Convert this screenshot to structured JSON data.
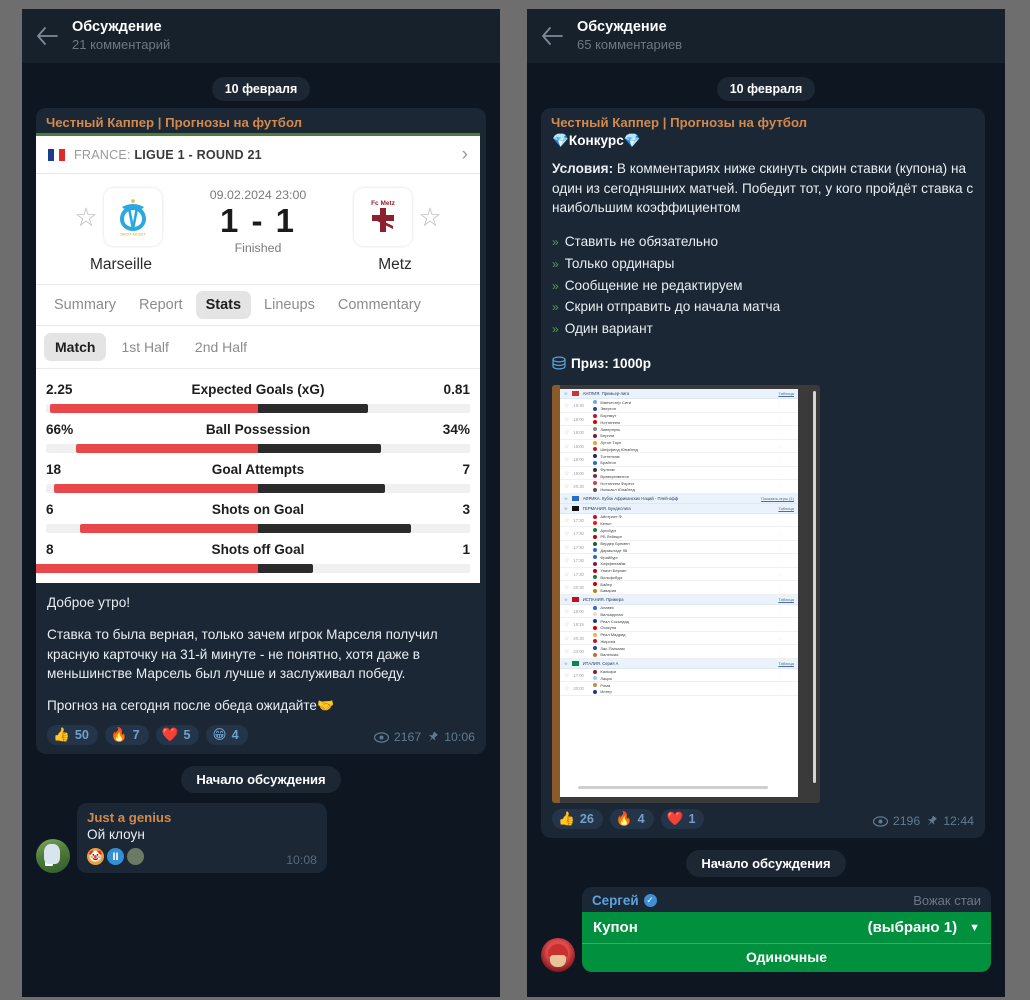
{
  "left": {
    "header": {
      "title": "Обсуждение",
      "subtitle": "21 комментарий",
      "back_icon": "back-arrow-icon"
    },
    "date_chip": "10 февраля",
    "channel": "Честный Каппер | Прогнозы на футбол",
    "sports_card": {
      "league": "FRANCE:",
      "league_bold": "LIGUE 1 - ROUND 21",
      "chevron": "›",
      "home_team": "Marseille",
      "away_team": "Metz",
      "home_logo_text": "OM",
      "away_logo_text": "Fc Metz",
      "kickoff": "09.02.2024 23:00",
      "score": "1 - 1",
      "status": "Finished",
      "tabs": [
        {
          "label": "Summary",
          "active": false
        },
        {
          "label": "Report",
          "active": false
        },
        {
          "label": "Stats",
          "active": true
        },
        {
          "label": "Lineups",
          "active": false
        },
        {
          "label": "Commentary",
          "active": false
        }
      ],
      "subtabs": [
        {
          "label": "Match",
          "active": true
        },
        {
          "label": "1st Half",
          "active": false
        },
        {
          "label": "2nd Half",
          "active": false
        }
      ],
      "stats": [
        {
          "label": "Expected Goals (xG)",
          "home": "2.25",
          "away": "0.81",
          "home_pct": 49,
          "away_pct": 26
        },
        {
          "label": "Ball Possession",
          "home": "66%",
          "away": "34%",
          "home_pct": 43,
          "away_pct": 29
        },
        {
          "label": "Goal Attempts",
          "home": "18",
          "away": "7",
          "home_pct": 48,
          "away_pct": 30
        },
        {
          "label": "Shots on Goal",
          "home": "6",
          "away": "3",
          "home_pct": 42,
          "away_pct": 36
        },
        {
          "label": "Shots off Goal",
          "home": "8",
          "away": "1",
          "home_pct": 62,
          "away_pct": 13
        }
      ]
    },
    "message_paragraphs": [
      "Доброе утро!",
      "Ставка то была верная, только зачем игрок Марселя получил красную карточку на 31-й минуте - не понятно, хотя даже в меньшинстве Марсель был лучше и заслуживал победу.",
      "Прогноз на сегодня после обеда ожидайте🤝"
    ],
    "reactions": [
      {
        "emoji": "👍",
        "count": "50"
      },
      {
        "emoji": "🔥",
        "count": "7"
      },
      {
        "emoji": "❤️",
        "count": "5"
      },
      {
        "emoji": "😁",
        "count": "4"
      }
    ],
    "views": "2167",
    "time": "10:06",
    "service_label": "Начало обсуждения",
    "comment": {
      "author": "Just a genius",
      "text": "Ой клоун",
      "time": "10:08",
      "reaction_avatars": [
        "🤡",
        "II",
        "👤"
      ]
    }
  },
  "right": {
    "header": {
      "title": "Обсуждение",
      "subtitle": "65 комментариев",
      "back_icon": "back-arrow-icon"
    },
    "date_chip": "10 февраля",
    "channel": "Честный Каппер | Прогнозы на футбол",
    "contest_title": "💎Конкурс💎",
    "conditions_label": "Условия:",
    "conditions_text": " В комментариях ниже скинуть скрин ставки (купона) на один из сегодняшних матчей. Победит тот, у кого пройдёт ставка с наибольшим коэффициентом",
    "bullets": [
      "Ставить не обязательно",
      "Только ординары",
      "Сообщение не редактируем",
      "Скрин отправить до начала матча",
      "Один вариант"
    ],
    "prize": "Приз: 1000р",
    "prize_icon": "coins-icon",
    "screenshot": {
      "alt": "betting-app-screenshot",
      "leagues": [
        {
          "name": "АНГЛИЯ. Премьер-лига",
          "table_link": "Таблица",
          "matches": [
            {
              "time": "15:30",
              "home": "Манчестер Сити",
              "away": "Эвертон",
              "score": "-"
            },
            {
              "time": "18:00",
              "home": "Борнмут",
              "away": "Ноттингем",
              "score": "-"
            },
            {
              "time": "18:00",
              "home": "Ливерпуль",
              "away": "Бернли",
              "score": "-"
            },
            {
              "time": "18:00",
              "home": "Лутон Таун",
              "away": "Шеффилд Юнайтед",
              "score": "-"
            },
            {
              "time": "18:00",
              "home": "Тоттенхэм",
              "away": "Брайтон",
              "score": "-"
            },
            {
              "time": "18:00",
              "home": "Фулхэм",
              "away": "Вулверхэмптон",
              "score": "-"
            },
            {
              "time": "20:30",
              "home": "Ноттингем Форест",
              "away": "Ньюкасл Юнайтед",
              "score": "-"
            }
          ]
        },
        {
          "name": "АФРИКА. Кубок Африканских Наций - Плей-офф",
          "table_link": "Показать игры (1)"
        },
        {
          "name": "ГЕРМАНИЯ. Бундеслига",
          "table_link": "Таблица",
          "matches": [
            {
              "time": "17:30",
              "home": "Айнтрахт Ф.",
              "away": "Кельн",
              "score": "-"
            },
            {
              "time": "17:30",
              "home": "Аугсбург",
              "away": "РБ Лейпциг",
              "score": "-"
            },
            {
              "time": "17:30",
              "home": "Вердер Бремен",
              "away": "Дармштадт 98",
              "score": "-"
            },
            {
              "time": "17:30",
              "home": "Фрайбург",
              "away": "Хоффенхайм",
              "score": "-"
            },
            {
              "time": "17:30",
              "home": "Унион Берлин",
              "away": "Вольфсбург",
              "score": "-"
            },
            {
              "time": "20:30",
              "home": "Байер",
              "away": "Бавария",
              "score": "-"
            }
          ]
        },
        {
          "name": "ИСПАНИЯ. Примера",
          "table_link": "Таблица",
          "matches": [
            {
              "time": "16:00",
              "home": "Алавес",
              "away": "Вильярреал",
              "score": "-"
            },
            {
              "time": "18:15",
              "home": "Реал Сосьедад",
              "away": "Осасуна",
              "score": "-"
            },
            {
              "time": "20:30",
              "home": "Реал Мадрид",
              "away": "Жирона",
              "score": "-"
            },
            {
              "time": "23:00",
              "home": "Лас-Пальмас",
              "away": "Валенсия",
              "score": "-"
            }
          ]
        },
        {
          "name": "ИТАЛИЯ. Серия А",
          "table_link": "Таблица",
          "matches": [
            {
              "time": "17:00",
              "home": "Кальяри",
              "away": "Лацио",
              "score": "-"
            },
            {
              "time": "20:00",
              "home": "Рома",
              "away": "Интер",
              "score": "-"
            }
          ]
        }
      ]
    },
    "reactions": [
      {
        "emoji": "👍",
        "count": "26"
      },
      {
        "emoji": "🔥",
        "count": "4"
      },
      {
        "emoji": "❤️",
        "count": "1"
      }
    ],
    "views": "2196",
    "time": "12:44",
    "service_label": "Начало обсуждения",
    "coupon_comment": {
      "author": "Сергей",
      "verified_icon": "verified-badge-icon",
      "badge": "Вожак стаи",
      "coupon_label": "Купон",
      "coupon_selected": "(выбрано 1)",
      "caret_icon": "chevron-down-icon",
      "coupon_type": "Одиночные"
    }
  },
  "colors": {
    "chat_bg": "#0e1621",
    "header_bg": "#17212b",
    "bubble_bg": "#1b2735",
    "channel_orange": "#d2894c",
    "stat_red": "#e8484a",
    "stat_dark": "#2b2b2b",
    "coupon_green": "#00903e"
  }
}
